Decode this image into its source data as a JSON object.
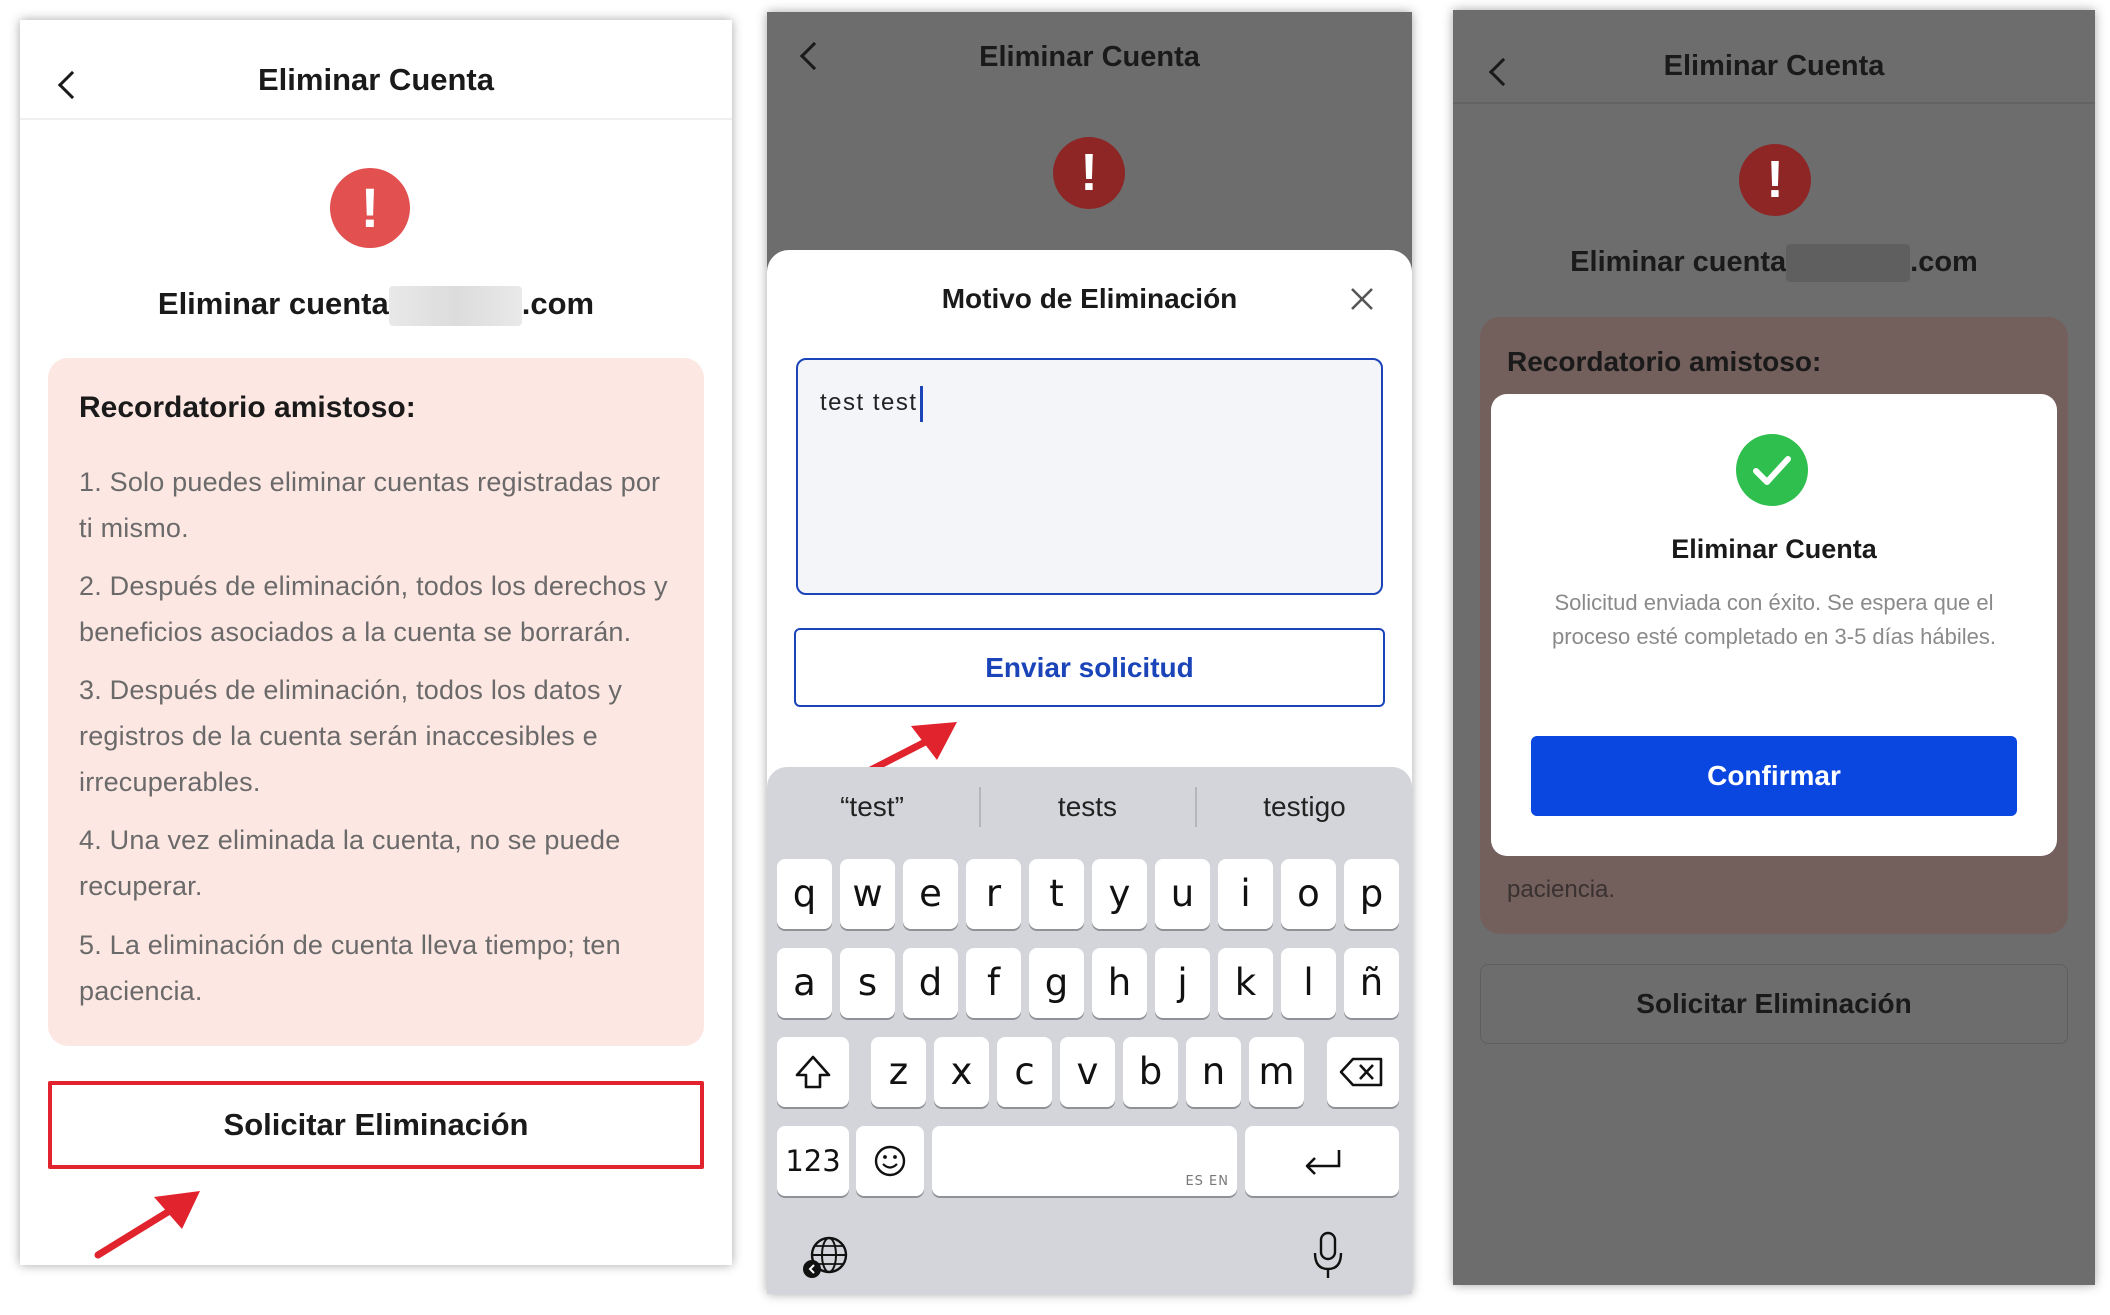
{
  "screen1": {
    "title": "Eliminar Cuenta",
    "account_prefix": "Eliminar cuenta",
    "account_suffix": ".com",
    "reminder_title": "Recordatorio amistoso:",
    "reminders": [
      "1. Solo puedes eliminar cuentas registradas por ti mismo.",
      "2. Después de eliminación, todos los derechos y beneficios asociados a la cuenta se borrarán.",
      "3. Después de eliminación, todos los datos y registros de la cuenta serán inaccesibles e irrecuperables.",
      "4. Una vez eliminada la cuenta, no se puede recuperar.",
      "5. La eliminación de cuenta lleva tiempo; ten paciencia."
    ],
    "request_button": "Solicitar Eliminación",
    "highlight_color": "#e0232d"
  },
  "screen2": {
    "title": "Eliminar Cuenta",
    "sheet_title": "Motivo de Eliminación",
    "reason_value": "test test",
    "submit_button": "Enviar solicitud",
    "suggestions": [
      "“test”",
      "tests",
      "testigo"
    ],
    "keyboard_rows": [
      [
        "q",
        "w",
        "e",
        "r",
        "t",
        "y",
        "u",
        "i",
        "o",
        "p"
      ],
      [
        "a",
        "s",
        "d",
        "f",
        "g",
        "h",
        "j",
        "k",
        "l",
        "ñ"
      ],
      [
        "z",
        "x",
        "c",
        "v",
        "b",
        "n",
        "m"
      ]
    ],
    "key_123": "123",
    "space_label": "ES EN",
    "accent_color": "#1a44b8"
  },
  "screen3": {
    "title": "Eliminar Cuenta",
    "account_prefix": "Eliminar cuenta",
    "account_suffix": ".com",
    "reminder_title": "Recordatorio amistoso:",
    "reminder_tail": "paciencia.",
    "dialog_title": "Eliminar Cuenta",
    "dialog_message": "Solicitud enviada con éxito. Se espera que el proceso esté completado en 3-5 días hábiles.",
    "confirm_button": "Confirmar",
    "request_button": "Solicitar Eliminación",
    "confirm_color": "#0a47e0",
    "success_color": "#2fbf4e"
  }
}
